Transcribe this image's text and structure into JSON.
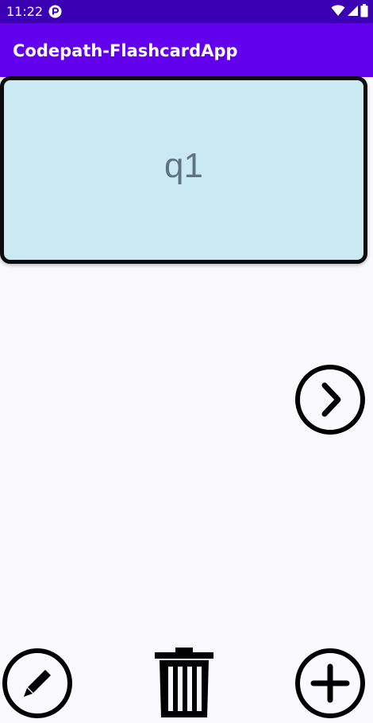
{
  "status_bar": {
    "time": "11:22",
    "icons": [
      "notification-icon",
      "wifi-icon",
      "signal-icon",
      "battery-icon"
    ]
  },
  "app_bar": {
    "title": "Codepath-FlashcardApp"
  },
  "flashcard": {
    "text": "q1"
  },
  "actions": {
    "next_icon": "chevron-right-circle-icon",
    "edit_icon": "pencil-circle-icon",
    "delete_icon": "trash-icon",
    "add_icon": "plus-circle-icon"
  },
  "colors": {
    "status_bar": "#3b00b3",
    "app_bar": "#6200ee",
    "card_background": "#cbe9f2",
    "card_text": "#5e7383",
    "background": "#faf9fd"
  }
}
